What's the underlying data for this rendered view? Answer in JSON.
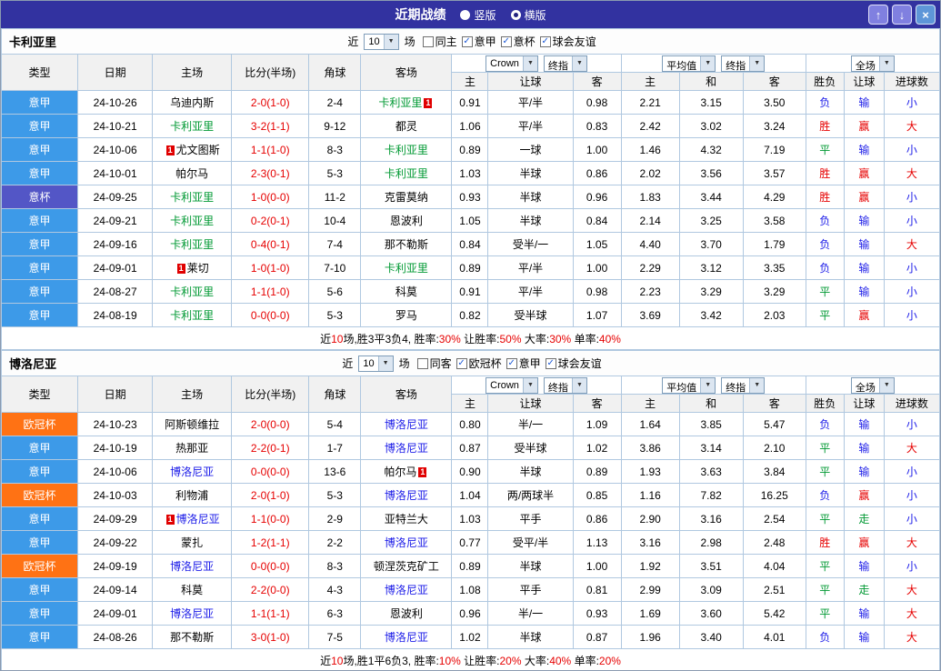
{
  "titlebar": {
    "title": "近期战绩",
    "radios": [
      {
        "label": "竖版",
        "selected": false
      },
      {
        "label": "横版",
        "selected": true
      }
    ],
    "buttons": [
      {
        "name": "move-up",
        "icon": "up-arrow-icon",
        "glyph": "↑",
        "bg": "#8080E0"
      },
      {
        "name": "move-down",
        "icon": "down-arrow-icon",
        "glyph": "↓",
        "bg": "#8080E0"
      },
      {
        "name": "close",
        "icon": "close-icon",
        "glyph": "×",
        "bg": "#5E96D8"
      }
    ]
  },
  "labels": {
    "near": "近",
    "games": "场"
  },
  "headers": {
    "main": [
      "类型",
      "日期",
      "主场",
      "比分(半场)",
      "角球",
      "客场"
    ],
    "sub": [
      "主",
      "让球",
      "客",
      "主",
      "和",
      "客",
      "胜负",
      "让球",
      "进球数"
    ],
    "selects": {
      "book": "Crown",
      "final": "终指",
      "avg": "平均值",
      "full": "全场"
    }
  },
  "colors": {
    "titlebar_bg": "#3232A0",
    "league": {
      "意甲": "#3D9AE8",
      "意杯": "#5356C6",
      "欧冠杯": "#FF7214"
    },
    "result": {
      "r": "#E60000",
      "g": "#009933",
      "b": "#1C1CE8"
    },
    "score": "#E60000",
    "card": "#E00000"
  },
  "sections": [
    {
      "team": "卡利亚里",
      "team_color": "#009933",
      "filter": {
        "count": "10",
        "checkboxes": [
          {
            "label": "同主",
            "checked": false
          },
          {
            "label": "意甲",
            "checked": true
          },
          {
            "label": "意杯",
            "checked": true
          },
          {
            "label": "球会友谊",
            "checked": true
          }
        ]
      },
      "rows": [
        {
          "league": "意甲",
          "date": "24-10-26",
          "home": {
            "name": "乌迪内斯"
          },
          "score": "2-0(1-0)",
          "corners": "2-4",
          "away": {
            "name": "卡利亚里",
            "team": true,
            "card": "1",
            "side": "right"
          },
          "odds": [
            "0.91",
            "平/半",
            "0.98"
          ],
          "avg": [
            "2.21",
            "3.15",
            "3.50"
          ],
          "res": [
            [
              "负",
              "b"
            ],
            [
              "输",
              "b"
            ],
            [
              "小",
              "b"
            ]
          ]
        },
        {
          "league": "意甲",
          "date": "24-10-21",
          "home": {
            "name": "卡利亚里",
            "team": true
          },
          "score": "3-2(1-1)",
          "corners": "9-12",
          "away": {
            "name": "都灵"
          },
          "odds": [
            "1.06",
            "平/半",
            "0.83"
          ],
          "avg": [
            "2.42",
            "3.02",
            "3.24"
          ],
          "res": [
            [
              "胜",
              "r"
            ],
            [
              "赢",
              "r"
            ],
            [
              "大",
              "r"
            ]
          ]
        },
        {
          "league": "意甲",
          "date": "24-10-06",
          "home": {
            "name": "尤文图斯",
            "card": "1",
            "side": "left"
          },
          "score": "1-1(1-0)",
          "corners": "8-3",
          "away": {
            "name": "卡利亚里",
            "team": true
          },
          "odds": [
            "0.89",
            "一球",
            "1.00"
          ],
          "avg": [
            "1.46",
            "4.32",
            "7.19"
          ],
          "res": [
            [
              "平",
              "g"
            ],
            [
              "输",
              "b"
            ],
            [
              "小",
              "b"
            ]
          ]
        },
        {
          "league": "意甲",
          "date": "24-10-01",
          "home": {
            "name": "帕尔马"
          },
          "score": "2-3(0-1)",
          "corners": "5-3",
          "away": {
            "name": "卡利亚里",
            "team": true
          },
          "odds": [
            "1.03",
            "半球",
            "0.86"
          ],
          "avg": [
            "2.02",
            "3.56",
            "3.57"
          ],
          "res": [
            [
              "胜",
              "r"
            ],
            [
              "赢",
              "r"
            ],
            [
              "大",
              "r"
            ]
          ]
        },
        {
          "league": "意杯",
          "date": "24-09-25",
          "home": {
            "name": "卡利亚里",
            "team": true
          },
          "score": "1-0(0-0)",
          "corners": "11-2",
          "away": {
            "name": "克雷莫纳"
          },
          "odds": [
            "0.93",
            "半球",
            "0.96"
          ],
          "avg": [
            "1.83",
            "3.44",
            "4.29"
          ],
          "res": [
            [
              "胜",
              "r"
            ],
            [
              "赢",
              "r"
            ],
            [
              "小",
              "b"
            ]
          ]
        },
        {
          "league": "意甲",
          "date": "24-09-21",
          "home": {
            "name": "卡利亚里",
            "team": true
          },
          "score": "0-2(0-1)",
          "corners": "10-4",
          "away": {
            "name": "恩波利"
          },
          "odds": [
            "1.05",
            "半球",
            "0.84"
          ],
          "avg": [
            "2.14",
            "3.25",
            "3.58"
          ],
          "res": [
            [
              "负",
              "b"
            ],
            [
              "输",
              "b"
            ],
            [
              "小",
              "b"
            ]
          ]
        },
        {
          "league": "意甲",
          "date": "24-09-16",
          "home": {
            "name": "卡利亚里",
            "team": true
          },
          "score": "0-4(0-1)",
          "corners": "7-4",
          "away": {
            "name": "那不勒斯"
          },
          "odds": [
            "0.84",
            "受半/一",
            "1.05"
          ],
          "avg": [
            "4.40",
            "3.70",
            "1.79"
          ],
          "res": [
            [
              "负",
              "b"
            ],
            [
              "输",
              "b"
            ],
            [
              "大",
              "r"
            ]
          ]
        },
        {
          "league": "意甲",
          "date": "24-09-01",
          "home": {
            "name": "莱切",
            "card": "1",
            "side": "left"
          },
          "score": "1-0(1-0)",
          "corners": "7-10",
          "away": {
            "name": "卡利亚里",
            "team": true
          },
          "odds": [
            "0.89",
            "平/半",
            "1.00"
          ],
          "avg": [
            "2.29",
            "3.12",
            "3.35"
          ],
          "res": [
            [
              "负",
              "b"
            ],
            [
              "输",
              "b"
            ],
            [
              "小",
              "b"
            ]
          ]
        },
        {
          "league": "意甲",
          "date": "24-08-27",
          "home": {
            "name": "卡利亚里",
            "team": true
          },
          "score": "1-1(1-0)",
          "corners": "5-6",
          "away": {
            "name": "科莫"
          },
          "odds": [
            "0.91",
            "平/半",
            "0.98"
          ],
          "avg": [
            "2.23",
            "3.29",
            "3.29"
          ],
          "res": [
            [
              "平",
              "g"
            ],
            [
              "输",
              "b"
            ],
            [
              "小",
              "b"
            ]
          ]
        },
        {
          "league": "意甲",
          "date": "24-08-19",
          "home": {
            "name": "卡利亚里",
            "team": true
          },
          "score": "0-0(0-0)",
          "corners": "5-3",
          "away": {
            "name": "罗马"
          },
          "odds": [
            "0.82",
            "受半球",
            "1.07"
          ],
          "avg": [
            "3.69",
            "3.42",
            "2.03"
          ],
          "res": [
            [
              "平",
              "g"
            ],
            [
              "赢",
              "r"
            ],
            [
              "小",
              "b"
            ]
          ]
        }
      ],
      "summary": [
        [
          "近",
          0
        ],
        [
          "10",
          1
        ],
        [
          "场,胜3平3负4, 胜率:",
          0
        ],
        [
          "30%",
          1
        ],
        [
          " 让胜率:",
          0
        ],
        [
          "50%",
          1
        ],
        [
          " 大率:",
          0
        ],
        [
          "30%",
          1
        ],
        [
          " 单率:",
          0
        ],
        [
          "40%",
          1
        ]
      ]
    },
    {
      "team": "博洛尼亚",
      "team_color": "#1C1CE8",
      "filter": {
        "count": "10",
        "checkboxes": [
          {
            "label": "同客",
            "checked": false
          },
          {
            "label": "欧冠杯",
            "checked": true
          },
          {
            "label": "意甲",
            "checked": true
          },
          {
            "label": "球会友谊",
            "checked": true
          }
        ]
      },
      "rows": [
        {
          "league": "欧冠杯",
          "date": "24-10-23",
          "home": {
            "name": "阿斯顿维拉"
          },
          "score": "2-0(0-0)",
          "corners": "5-4",
          "away": {
            "name": "博洛尼亚",
            "team": true
          },
          "odds": [
            "0.80",
            "半/一",
            "1.09"
          ],
          "avg": [
            "1.64",
            "3.85",
            "5.47"
          ],
          "res": [
            [
              "负",
              "b"
            ],
            [
              "输",
              "b"
            ],
            [
              "小",
              "b"
            ]
          ]
        },
        {
          "league": "意甲",
          "date": "24-10-19",
          "home": {
            "name": "热那亚"
          },
          "score": "2-2(0-1)",
          "corners": "1-7",
          "away": {
            "name": "博洛尼亚",
            "team": true
          },
          "odds": [
            "0.87",
            "受半球",
            "1.02"
          ],
          "avg": [
            "3.86",
            "3.14",
            "2.10"
          ],
          "res": [
            [
              "平",
              "g"
            ],
            [
              "输",
              "b"
            ],
            [
              "大",
              "r"
            ]
          ]
        },
        {
          "league": "意甲",
          "date": "24-10-06",
          "home": {
            "name": "博洛尼亚",
            "team": true
          },
          "score": "0-0(0-0)",
          "corners": "13-6",
          "away": {
            "name": "帕尔马",
            "card": "1",
            "side": "right"
          },
          "odds": [
            "0.90",
            "半球",
            "0.89"
          ],
          "avg": [
            "1.93",
            "3.63",
            "3.84"
          ],
          "res": [
            [
              "平",
              "g"
            ],
            [
              "输",
              "b"
            ],
            [
              "小",
              "b"
            ]
          ]
        },
        {
          "league": "欧冠杯",
          "date": "24-10-03",
          "home": {
            "name": "利物浦"
          },
          "score": "2-0(1-0)",
          "corners": "5-3",
          "away": {
            "name": "博洛尼亚",
            "team": true
          },
          "odds": [
            "1.04",
            "两/两球半",
            "0.85"
          ],
          "avg": [
            "1.16",
            "7.82",
            "16.25"
          ],
          "res": [
            [
              "负",
              "b"
            ],
            [
              "赢",
              "r"
            ],
            [
              "小",
              "b"
            ]
          ]
        },
        {
          "league": "意甲",
          "date": "24-09-29",
          "home": {
            "name": "博洛尼亚",
            "team": true,
            "card": "1",
            "side": "left"
          },
          "score": "1-1(0-0)",
          "corners": "2-9",
          "away": {
            "name": "亚特兰大"
          },
          "odds": [
            "1.03",
            "平手",
            "0.86"
          ],
          "avg": [
            "2.90",
            "3.16",
            "2.54"
          ],
          "res": [
            [
              "平",
              "g"
            ],
            [
              "走",
              "g"
            ],
            [
              "小",
              "b"
            ]
          ]
        },
        {
          "league": "意甲",
          "date": "24-09-22",
          "home": {
            "name": "蒙扎"
          },
          "score": "1-2(1-1)",
          "corners": "2-2",
          "away": {
            "name": "博洛尼亚",
            "team": true
          },
          "odds": [
            "0.77",
            "受平/半",
            "1.13"
          ],
          "avg": [
            "3.16",
            "2.98",
            "2.48"
          ],
          "res": [
            [
              "胜",
              "r"
            ],
            [
              "赢",
              "r"
            ],
            [
              "大",
              "r"
            ]
          ]
        },
        {
          "league": "欧冠杯",
          "date": "24-09-19",
          "home": {
            "name": "博洛尼亚",
            "team": true
          },
          "score": "0-0(0-0)",
          "corners": "8-3",
          "away": {
            "name": "顿涅茨克矿工"
          },
          "odds": [
            "0.89",
            "半球",
            "1.00"
          ],
          "avg": [
            "1.92",
            "3.51",
            "4.04"
          ],
          "res": [
            [
              "平",
              "g"
            ],
            [
              "输",
              "b"
            ],
            [
              "小",
              "b"
            ]
          ]
        },
        {
          "league": "意甲",
          "date": "24-09-14",
          "home": {
            "name": "科莫"
          },
          "score": "2-2(0-0)",
          "corners": "4-3",
          "away": {
            "name": "博洛尼亚",
            "team": true
          },
          "odds": [
            "1.08",
            "平手",
            "0.81"
          ],
          "avg": [
            "2.99",
            "3.09",
            "2.51"
          ],
          "res": [
            [
              "平",
              "g"
            ],
            [
              "走",
              "g"
            ],
            [
              "大",
              "r"
            ]
          ]
        },
        {
          "league": "意甲",
          "date": "24-09-01",
          "home": {
            "name": "博洛尼亚",
            "team": true
          },
          "score": "1-1(1-1)",
          "corners": "6-3",
          "away": {
            "name": "恩波利"
          },
          "odds": [
            "0.96",
            "半/一",
            "0.93"
          ],
          "avg": [
            "1.69",
            "3.60",
            "5.42"
          ],
          "res": [
            [
              "平",
              "g"
            ],
            [
              "输",
              "b"
            ],
            [
              "大",
              "r"
            ]
          ]
        },
        {
          "league": "意甲",
          "date": "24-08-26",
          "home": {
            "name": "那不勒斯"
          },
          "score": "3-0(1-0)",
          "corners": "7-5",
          "away": {
            "name": "博洛尼亚",
            "team": true
          },
          "odds": [
            "1.02",
            "半球",
            "0.87"
          ],
          "avg": [
            "1.96",
            "3.40",
            "4.01"
          ],
          "res": [
            [
              "负",
              "b"
            ],
            [
              "输",
              "b"
            ],
            [
              "大",
              "r"
            ]
          ]
        }
      ],
      "summary": [
        [
          "近",
          0
        ],
        [
          "10",
          1
        ],
        [
          "场,胜1平6负3, 胜率:",
          0
        ],
        [
          "10%",
          1
        ],
        [
          " 让胜率:",
          0
        ],
        [
          "20%",
          1
        ],
        [
          " 大率:",
          0
        ],
        [
          "40%",
          1
        ],
        [
          " 单率:",
          0
        ],
        [
          "20%",
          1
        ]
      ]
    }
  ]
}
